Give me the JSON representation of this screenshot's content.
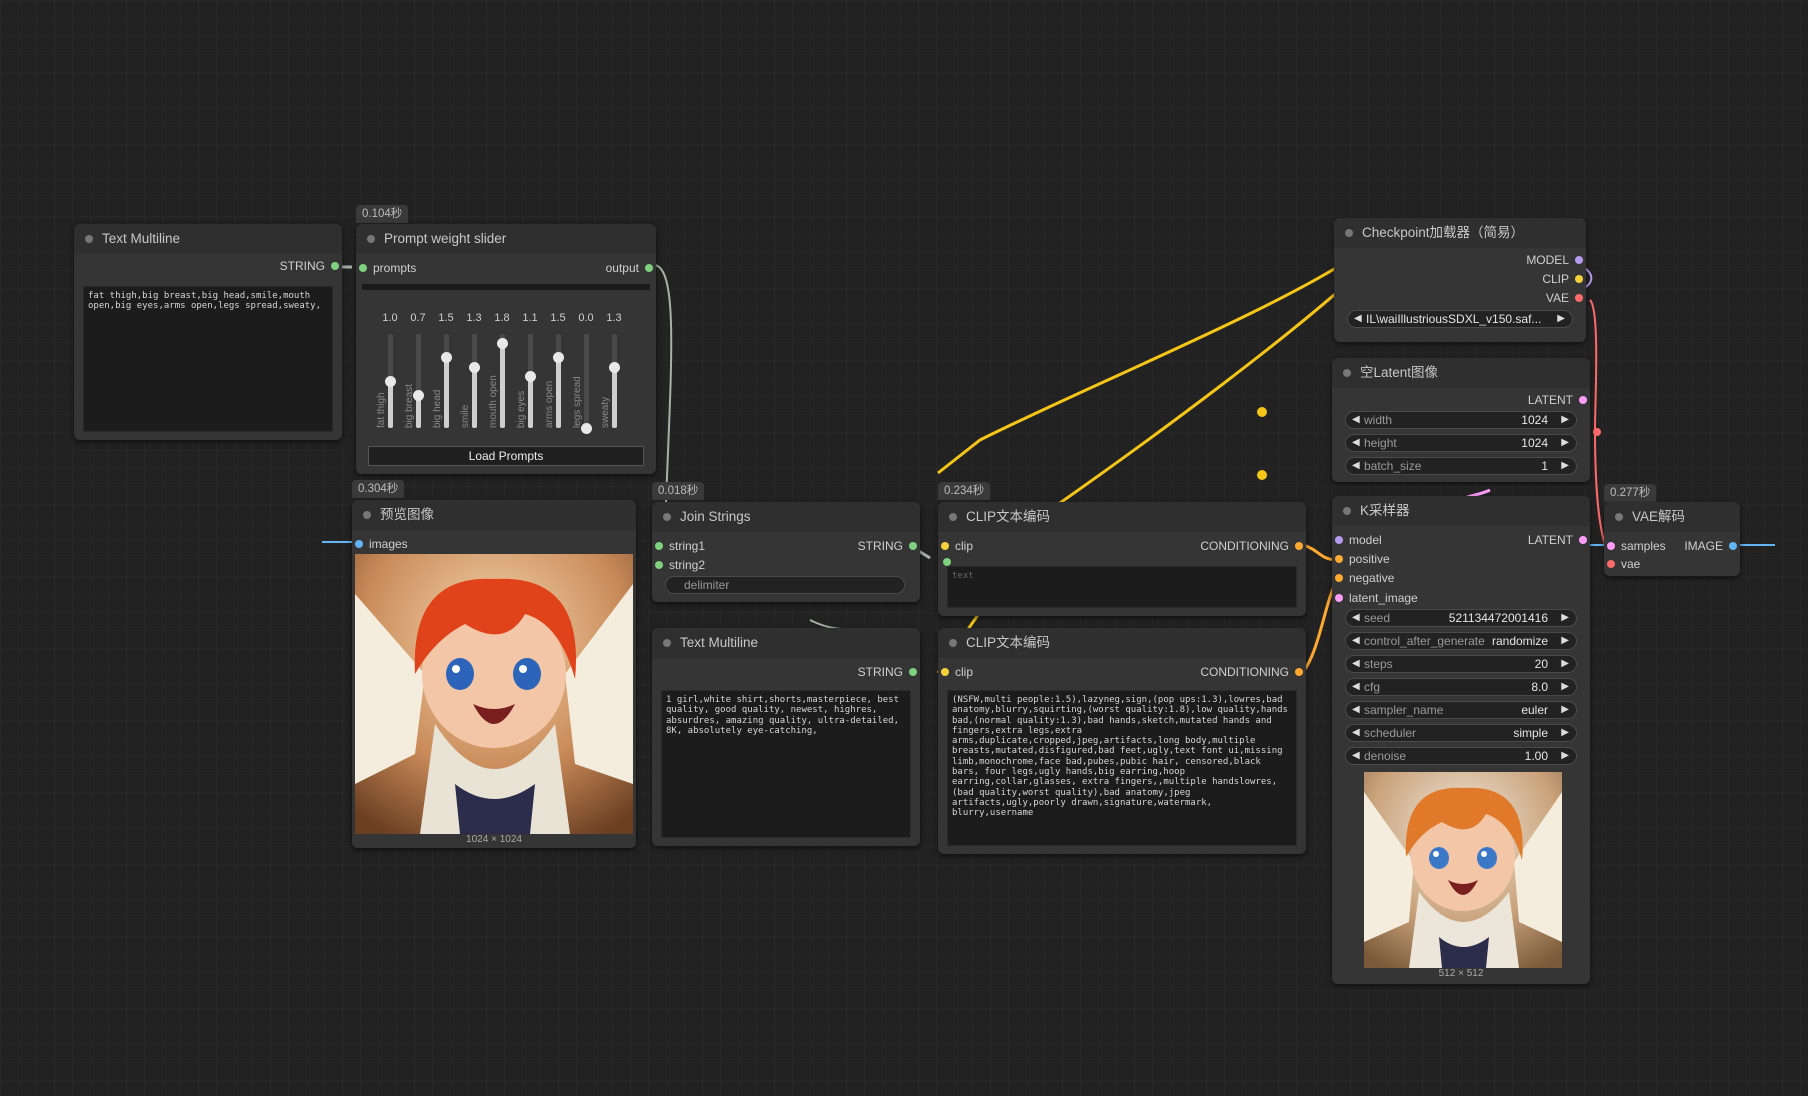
{
  "nodes": {
    "text1": {
      "title": "Text Multiline",
      "output": "STRING",
      "text": "fat thigh,big breast,big head,smile,mouth open,big eyes,arms open,legs spread,sweaty,"
    },
    "slider": {
      "time": "0.104秒",
      "title": "Prompt weight slider",
      "input": "prompts",
      "output": "output",
      "load_button": "Load Prompts",
      "sliders": [
        {
          "name": "fat thigh",
          "value": "1.0",
          "level": 0.5
        },
        {
          "name": "big breast",
          "value": "0.7",
          "level": 0.35
        },
        {
          "name": "big head",
          "value": "1.5",
          "level": 0.75
        },
        {
          "name": "smile",
          "value": "1.3",
          "level": 0.65
        },
        {
          "name": "mouth open",
          "value": "1.8",
          "level": 0.9
        },
        {
          "name": "big eyes",
          "value": "1.1",
          "level": 0.55
        },
        {
          "name": "arms open",
          "value": "1.5",
          "level": 0.75
        },
        {
          "name": "legs spread",
          "value": "0.0",
          "level": 0.0
        },
        {
          "name": "sweaty",
          "value": "1.3",
          "level": 0.65
        }
      ]
    },
    "preview": {
      "time": "0.304秒",
      "title": "预览图像",
      "input": "images",
      "caption": "1024 × 1024"
    },
    "join": {
      "time": "0.018秒",
      "title": "Join Strings",
      "inputs": [
        "string1",
        "string2"
      ],
      "output": "STRING",
      "delimiter": "delimiter"
    },
    "text2": {
      "title": "Text Multiline",
      "output": "STRING",
      "text": "1 girl,white shirt,shorts,masterpiece, best quality, good quality, newest, highres, absurdres, amazing quality, ultra-detailed, 8K, absolutely eye-catching,"
    },
    "clip_pos": {
      "time": "0.234秒",
      "title": "CLIP文本编码",
      "input": "clip",
      "output": "CONDITIONING",
      "text": "text"
    },
    "clip_neg": {
      "title": "CLIP文本编码",
      "input": "clip",
      "output": "CONDITIONING",
      "text": "(NSFW,multi people:1.5),lazyneg,sign,(pop ups:1.3),lowres,bad anatomy,blurry,squirting,(worst quality:1.8),low quality,hands bad,(normal quality:1.3),bad hands,sketch,mutated hands and fingers,extra legs,extra arms,duplicate,cropped,jpeg,artifacts,long body,multiple breasts,mutated,disfigured,bad feet,ugly,text font ui,missing limb,monochrome,face bad,pubes,pubic hair, censored,black bars, four legs,ugly hands,big earring,hoop earring,collar,glasses, extra fingers,,multiple handslowres,(bad quality,worst quality),bad anatomy,jpeg artifacts,ugly,poorly drawn,signature,watermark, blurry,username"
    },
    "checkpoint": {
      "title": "Checkpoint加载器（简易）",
      "outputs": [
        "MODEL",
        "CLIP",
        "VAE"
      ],
      "ckpt": "IL\\waiIllustriousSDXL_v150.saf..."
    },
    "latent": {
      "title": "空Latent图像",
      "output": "LATENT",
      "widgets": [
        {
          "label": "width",
          "value": "1024"
        },
        {
          "label": "height",
          "value": "1024"
        },
        {
          "label": "batch_size",
          "value": "1"
        }
      ]
    },
    "ksampler": {
      "title": "K采样器",
      "inputs": [
        "model",
        "positive",
        "negative",
        "latent_image"
      ],
      "output": "LATENT",
      "widgets": [
        {
          "label": "seed",
          "value": "521134472001416"
        },
        {
          "label": "control_after_generate",
          "value": "randomize"
        },
        {
          "label": "steps",
          "value": "20"
        },
        {
          "label": "cfg",
          "value": "8.0"
        },
        {
          "label": "sampler_name",
          "value": "euler"
        },
        {
          "label": "scheduler",
          "value": "simple"
        },
        {
          "label": "denoise",
          "value": "1.00"
        }
      ],
      "caption": "512 × 512"
    },
    "vae": {
      "time": "0.277秒",
      "title": "VAE解码",
      "inputs": [
        "samples",
        "vae"
      ],
      "output": "IMAGE"
    }
  },
  "colors": {
    "string": "#7fd07f",
    "clip": "#f5d23c",
    "model": "#b59cf0",
    "vae": "#ff6b6b",
    "latent": "#ff9cf9",
    "conditioning": "#ffa931",
    "image": "#64b5f6"
  }
}
